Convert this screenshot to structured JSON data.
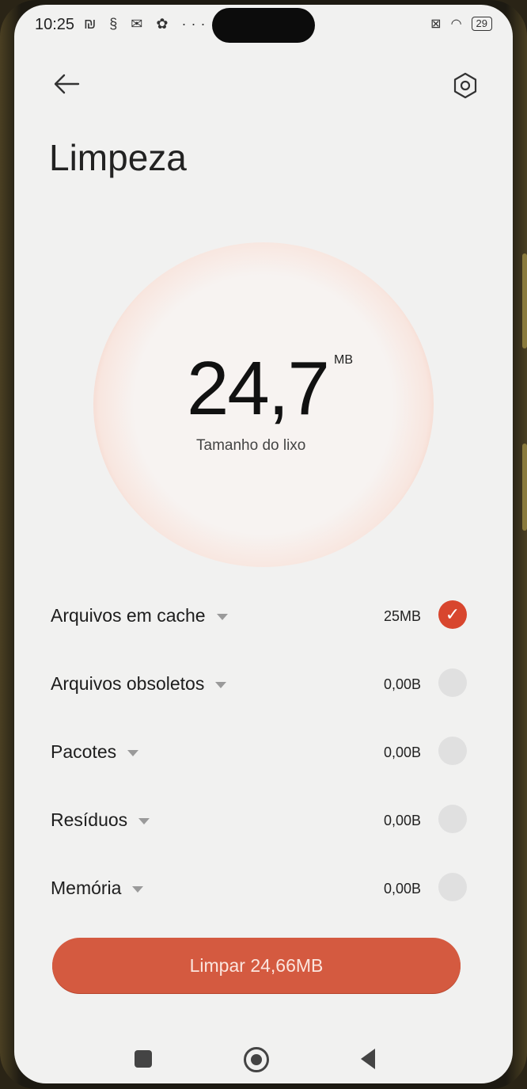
{
  "status_bar": {
    "time": "10:25",
    "battery": "29"
  },
  "header": {
    "title": "Limpeza"
  },
  "summary": {
    "value": "24,7",
    "unit": "MB",
    "caption": "Tamanho do lixo"
  },
  "items": [
    {
      "label": "Arquivos em cache",
      "size": "25MB",
      "checked": true
    },
    {
      "label": "Arquivos obsoletos",
      "size": "0,00B",
      "checked": false
    },
    {
      "label": "Pacotes",
      "size": "0,00B",
      "checked": false
    },
    {
      "label": "Resíduos",
      "size": "0,00B",
      "checked": false
    },
    {
      "label": "Memória",
      "size": "0,00B",
      "checked": false
    }
  ],
  "action": {
    "clean_label": "Limpar 24,66MB"
  },
  "colors": {
    "accent": "#d8462e",
    "button": "#d45a40"
  }
}
